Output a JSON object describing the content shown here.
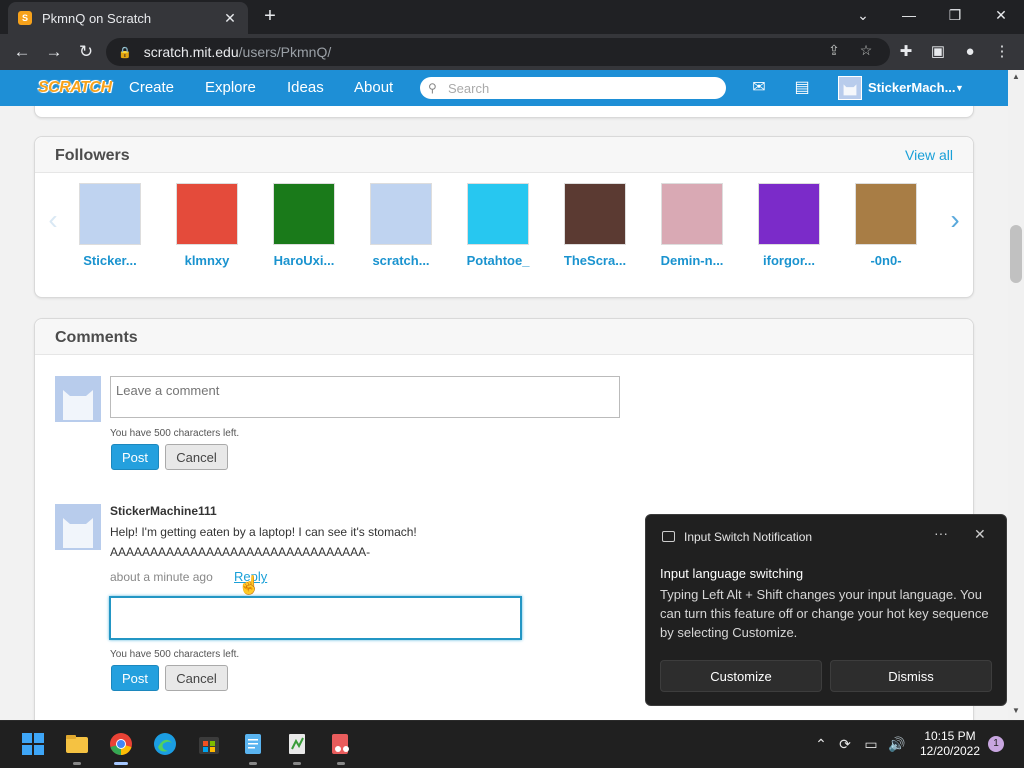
{
  "browser": {
    "tab_title": "PkmnQ on Scratch",
    "url_host": "scratch.mit.edu",
    "url_path": "/users/PkmnQ/"
  },
  "scratch_nav": {
    "logo": "SCRATCH",
    "links": [
      "Create",
      "Explore",
      "Ideas",
      "About"
    ],
    "search_placeholder": "Search",
    "username": "StickerMach..."
  },
  "followers": {
    "title": "Followers",
    "view_all": "View all",
    "items": [
      {
        "name": "Sticker...",
        "color": "#bfd3f0"
      },
      {
        "name": "klmnxy",
        "color": "#e44b3b"
      },
      {
        "name": "HaroUxi...",
        "color": "#1a7a1a"
      },
      {
        "name": "scratch...",
        "color": "#bfd3f0"
      },
      {
        "name": "Potahtoe_",
        "color": "#27c7f0"
      },
      {
        "name": "TheScra...",
        "color": "#5b3a32"
      },
      {
        "name": "Demin-n...",
        "color": "#d9a9b4"
      },
      {
        "name": "iforgor...",
        "color": "#7b2bc9"
      },
      {
        "name": "-0n0-",
        "color": "#a87d45"
      }
    ]
  },
  "comments": {
    "title": "Comments",
    "new_placeholder": "Leave a comment",
    "chars_left": "You have 500 characters left.",
    "post_label": "Post",
    "cancel_label": "Cancel",
    "entries": [
      {
        "user": "StickerMachine111",
        "line1": "Help! I'm getting eaten by a laptop! I can see it's stomach!",
        "line2": "AAAAAAAAAAAAAAAAAAAAAAAAAAAAAAAA-",
        "time": "about a minute ago",
        "reply": "Reply"
      }
    ]
  },
  "notification": {
    "app": "Input Switch Notification",
    "more": "···",
    "title": "Input language switching",
    "body": "Typing Left Alt + Shift changes your input language. You can turn this feature off or change your hot key sequence by selecting Customize.",
    "customize": "Customize",
    "dismiss": "Dismiss"
  },
  "taskbar": {
    "time": "10:15 PM",
    "date": "12/20/2022",
    "badge": "1"
  }
}
